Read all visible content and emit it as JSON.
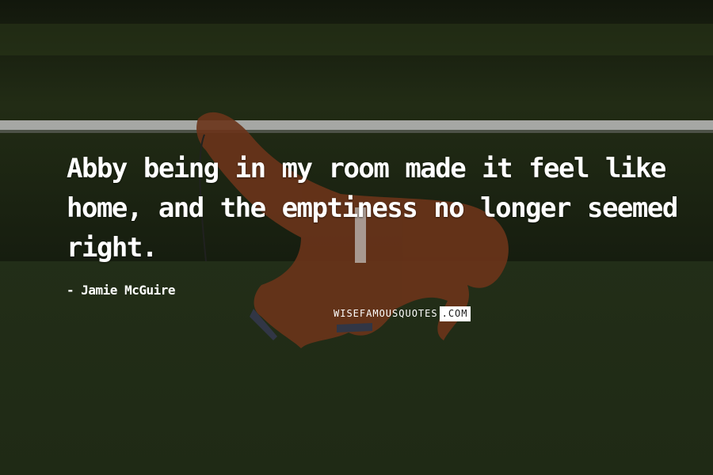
{
  "quote": {
    "text": "Abby being in my room made it feel like home, and the emptiness no longer seemed right.",
    "author": "- Jamie McGuire"
  },
  "watermark": {
    "left": "WISEFAMOUSQUOTES",
    "right": ".COM"
  },
  "background": {
    "description_icon": "racehorse-photo",
    "colors": {
      "hedge": "#1c2414",
      "grass": "#2a3a1c",
      "rail": "#cfcfcf",
      "horse": "#7a3a1c"
    }
  }
}
